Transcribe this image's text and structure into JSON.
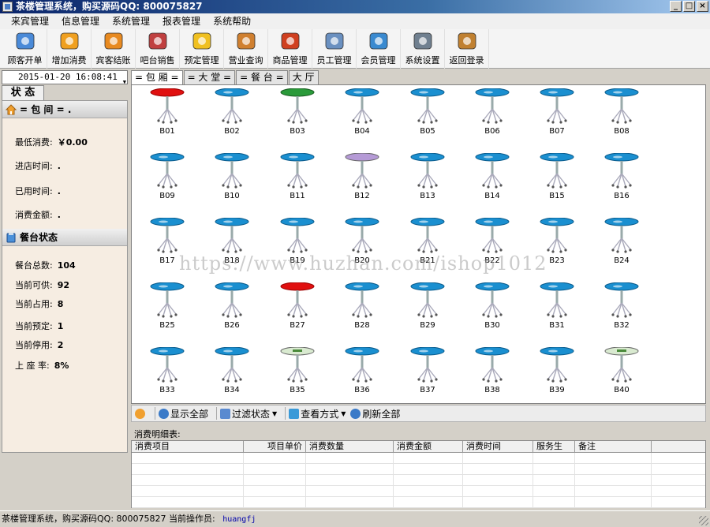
{
  "window": {
    "title": "茶楼管理系统，购买源码QQ: 800075827",
    "minimize": "_",
    "maximize": "□",
    "close": "×"
  },
  "menu": [
    "来宾管理",
    "信息管理",
    "系统管理",
    "报表管理",
    "系统帮助"
  ],
  "toolbar": [
    {
      "label": "顾客开单",
      "icon": "open-order-icon"
    },
    {
      "label": "增加消费",
      "icon": "add-consumption-icon"
    },
    {
      "label": "宾客结账",
      "icon": "checkout-icon"
    },
    {
      "label": "吧台销售",
      "icon": "bar-sales-icon"
    },
    {
      "label": "预定管理",
      "icon": "reservation-icon"
    },
    {
      "label": "营业查询",
      "icon": "business-query-icon"
    },
    {
      "label": "商品管理",
      "icon": "goods-icon"
    },
    {
      "label": "员工管理",
      "icon": "staff-icon"
    },
    {
      "label": "会员管理",
      "icon": "member-icon"
    },
    {
      "label": "系统设置",
      "icon": "settings-icon"
    },
    {
      "label": "返回登录",
      "icon": "exit-icon"
    }
  ],
  "left": {
    "datetime": "2015-01-20 16:08:41",
    "status_tab": "状 态",
    "room_section": "= 包 间 = .",
    "room_fields": [
      {
        "label": "最低消费:",
        "value": "￥0.00"
      },
      {
        "label": "进店时间:",
        "value": "."
      },
      {
        "label": "已用时间:",
        "value": "."
      },
      {
        "label": "消费金额:",
        "value": "."
      }
    ],
    "table_section": "餐台状态",
    "stats": [
      {
        "label": "餐台总数:",
        "value": "104"
      },
      {
        "label": "当前可供:",
        "value": "92"
      },
      {
        "label": "当前占用:",
        "value": "8"
      },
      {
        "label": "当前预定:",
        "value": "1"
      },
      {
        "label": "当前停用:",
        "value": "2"
      },
      {
        "label": "上 座 率:",
        "value": "8%"
      }
    ]
  },
  "tabs": [
    "= 包 厢 =",
    "= 大 堂 =",
    "= 餐 台 =",
    "大 厅"
  ],
  "tables": [
    {
      "id": "B01",
      "state": "occupied"
    },
    {
      "id": "B02",
      "state": "free"
    },
    {
      "id": "B03",
      "state": "reserved"
    },
    {
      "id": "B04",
      "state": "free"
    },
    {
      "id": "B05",
      "state": "free"
    },
    {
      "id": "B06",
      "state": "free"
    },
    {
      "id": "B07",
      "state": "free"
    },
    {
      "id": "B08",
      "state": "free"
    },
    {
      "id": "B09",
      "state": "free"
    },
    {
      "id": "B10",
      "state": "free"
    },
    {
      "id": "B11",
      "state": "free"
    },
    {
      "id": "B12",
      "state": "disabled"
    },
    {
      "id": "B13",
      "state": "free"
    },
    {
      "id": "B14",
      "state": "free"
    },
    {
      "id": "B15",
      "state": "free"
    },
    {
      "id": "B16",
      "state": "free"
    },
    {
      "id": "B17",
      "state": "free"
    },
    {
      "id": "B18",
      "state": "free"
    },
    {
      "id": "B19",
      "state": "free"
    },
    {
      "id": "B20",
      "state": "free"
    },
    {
      "id": "B21",
      "state": "free"
    },
    {
      "id": "B22",
      "state": "free"
    },
    {
      "id": "B23",
      "state": "free"
    },
    {
      "id": "B24",
      "state": "free"
    },
    {
      "id": "B25",
      "state": "free"
    },
    {
      "id": "B26",
      "state": "free"
    },
    {
      "id": "B27",
      "state": "occupied"
    },
    {
      "id": "B28",
      "state": "free"
    },
    {
      "id": "B29",
      "state": "free"
    },
    {
      "id": "B30",
      "state": "free"
    },
    {
      "id": "B31",
      "state": "free"
    },
    {
      "id": "B32",
      "state": "free"
    },
    {
      "id": "B33",
      "state": "free"
    },
    {
      "id": "B34",
      "state": "free"
    },
    {
      "id": "B35",
      "state": "labeled"
    },
    {
      "id": "B36",
      "state": "free"
    },
    {
      "id": "B37",
      "state": "free"
    },
    {
      "id": "B38",
      "state": "free"
    },
    {
      "id": "B39",
      "state": "free"
    },
    {
      "id": "B40",
      "state": "labeled"
    }
  ],
  "state_colors": {
    "free": "#1a8fd0",
    "occupied": "#e01010",
    "reserved": "#2a9a3a",
    "disabled": "#b59ad6",
    "labeled": "#d9ead0"
  },
  "watermark": "https://www.huzhan.com/ishop1012",
  "bottom_toolbar": {
    "show_all": "显示全部",
    "filter": "过滤状态",
    "view": "查看方式",
    "refresh": "刷新全部"
  },
  "detail": {
    "title": "消费明细表:",
    "columns": [
      "消费项目",
      "项目单价",
      "消费数量",
      "消费金额",
      "消费时间",
      "服务生",
      "备注"
    ]
  },
  "statusbar": {
    "text": "茶楼管理系统，购买源码QQ: 800075827 当前操作员:",
    "user": "huangfj"
  }
}
